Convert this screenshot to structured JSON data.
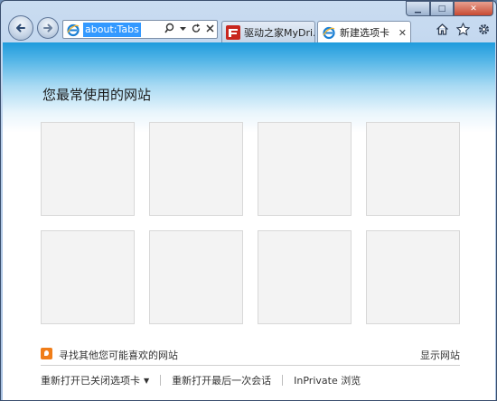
{
  "browser": {
    "address_value": "about:Tabs",
    "tabs": [
      {
        "label": "驱动之家MyDri...",
        "icon": "mydrivers-favicon",
        "active": false
      },
      {
        "label": "新建选项卡",
        "icon": "ie-favicon",
        "active": true,
        "close": "✕"
      }
    ],
    "window_controls": {
      "minimize": "▁",
      "maximize": "□",
      "close": "✕"
    }
  },
  "newtab": {
    "heading": "您最常使用的网站",
    "suggest_link": "寻找其他您可能喜欢的网站",
    "show_sites": "显示网站",
    "reopen_closed": "重新打开已关闭选项卡",
    "reopen_session": "重新打开最后一次会话",
    "inprivate": "InPrivate 浏览"
  },
  "colors": {
    "accent_top": "#1f9bdc",
    "tile_bg": "#f3f3f3",
    "suggest_icon": "#f07d19"
  }
}
